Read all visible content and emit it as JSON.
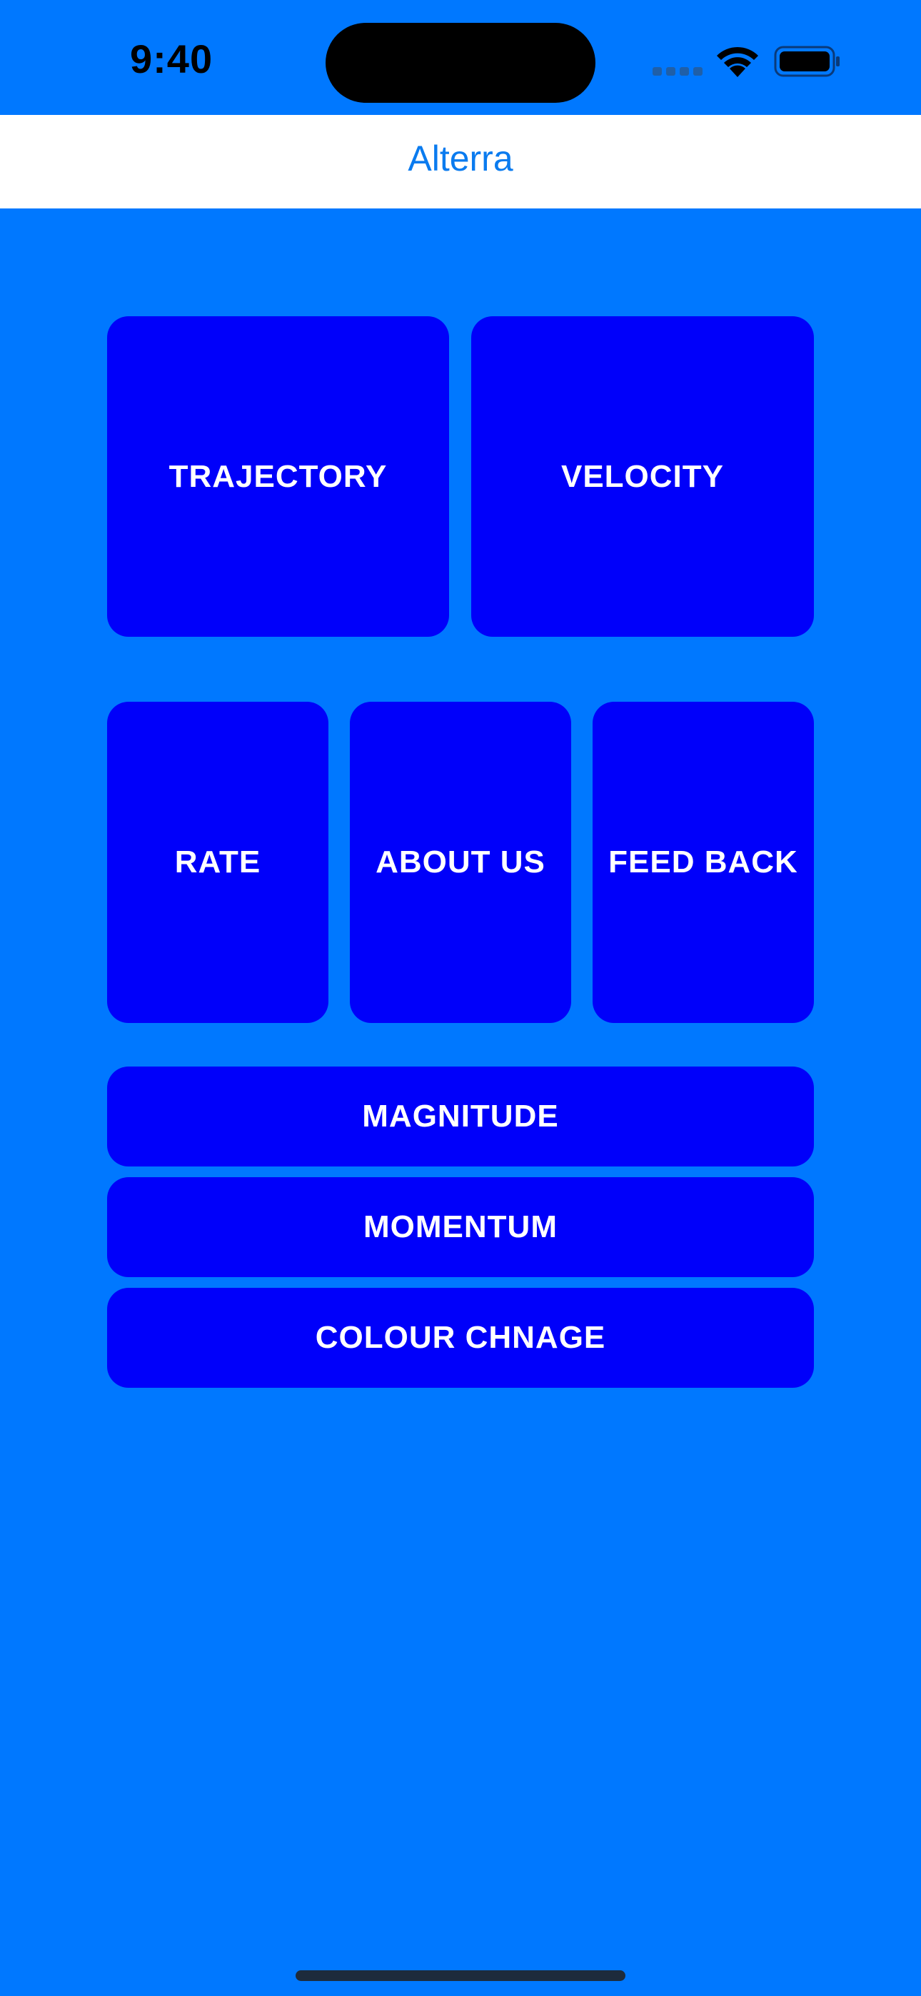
{
  "status_bar": {
    "time": "9:40",
    "icons": [
      "cellular-signal-icon",
      "wifi-icon",
      "battery-icon"
    ]
  },
  "nav": {
    "title": "Alterra"
  },
  "buttons": {
    "trajectory": "TRAJECTORY",
    "velocity": "VELOCITY",
    "rate": "RATE",
    "about_us": "ABOUT US",
    "feed_back": "FEED BACK",
    "magnitude": "MAGNITUDE",
    "momentum": "MOMENTUM",
    "colour_change": "COLOUR CHNAGE"
  },
  "colors": {
    "background": "#0078FF",
    "button": "#0000FA",
    "nav_bar": "#FFFFFF",
    "nav_title": "#0A7BEF",
    "button_text": "#FFFFFF"
  }
}
